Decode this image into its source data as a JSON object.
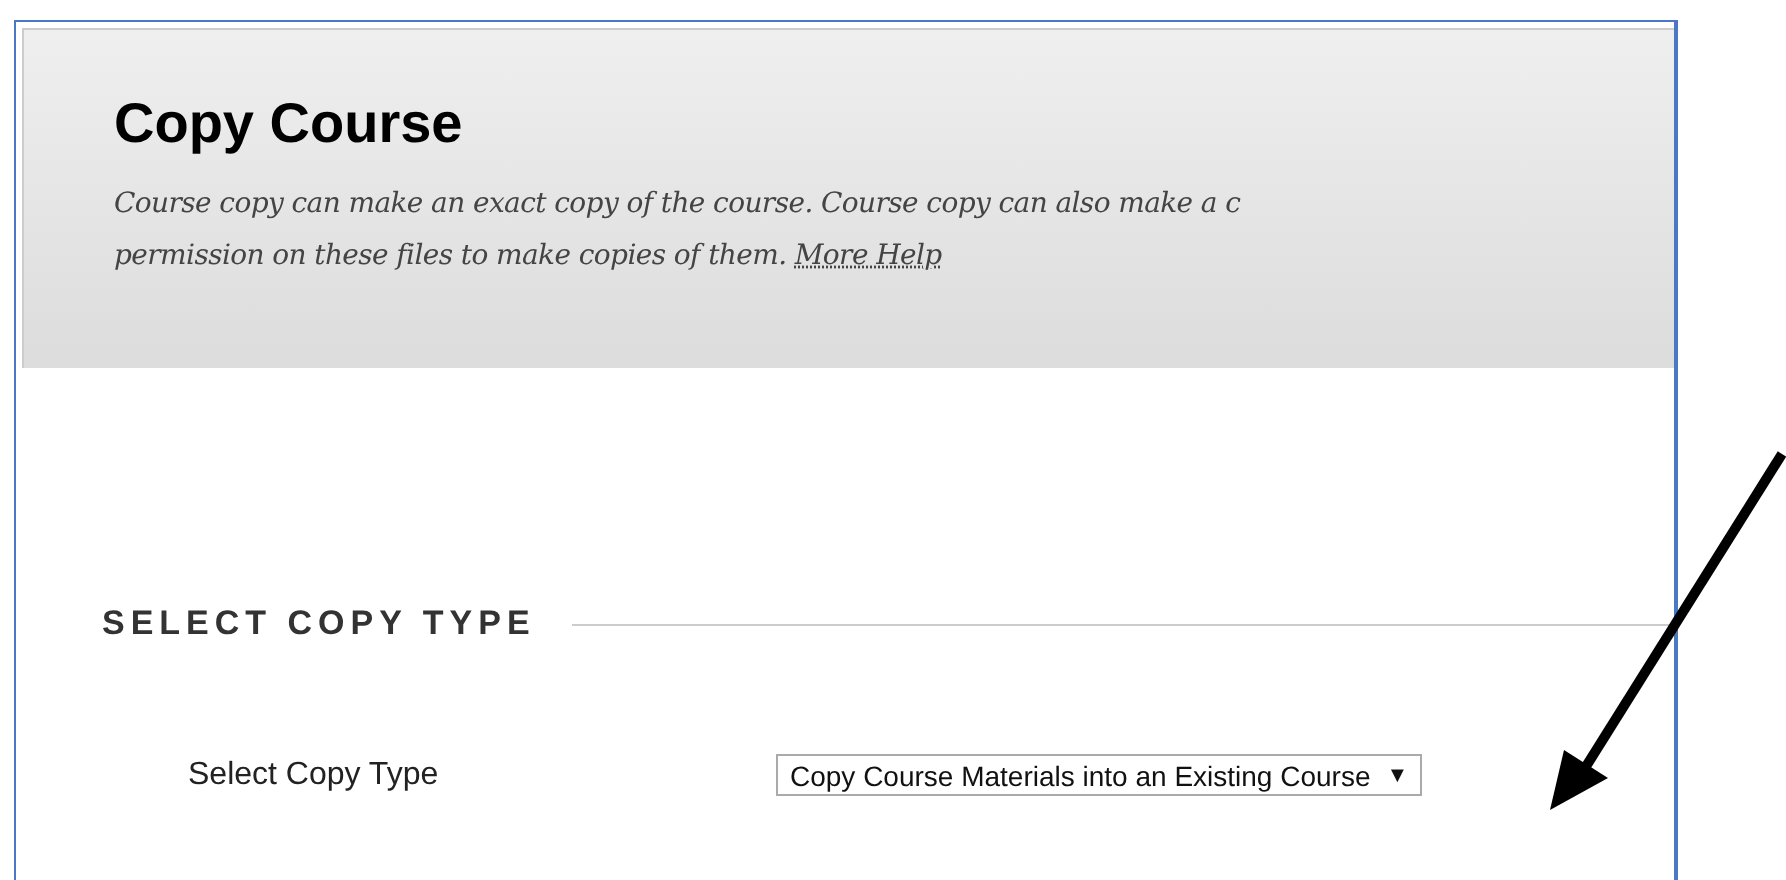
{
  "page": {
    "title": "Copy Course",
    "description_line_1": "Course copy can make an exact copy of the course. Course copy can also make a c",
    "description_line_2": "permission on these files to make copies of them.",
    "help_link": "More Help"
  },
  "section": {
    "heading": "SELECT COPY TYPE"
  },
  "field": {
    "label": "Select Copy Type",
    "value": "Copy Course Materials into an Existing Course",
    "caret": "▼"
  }
}
